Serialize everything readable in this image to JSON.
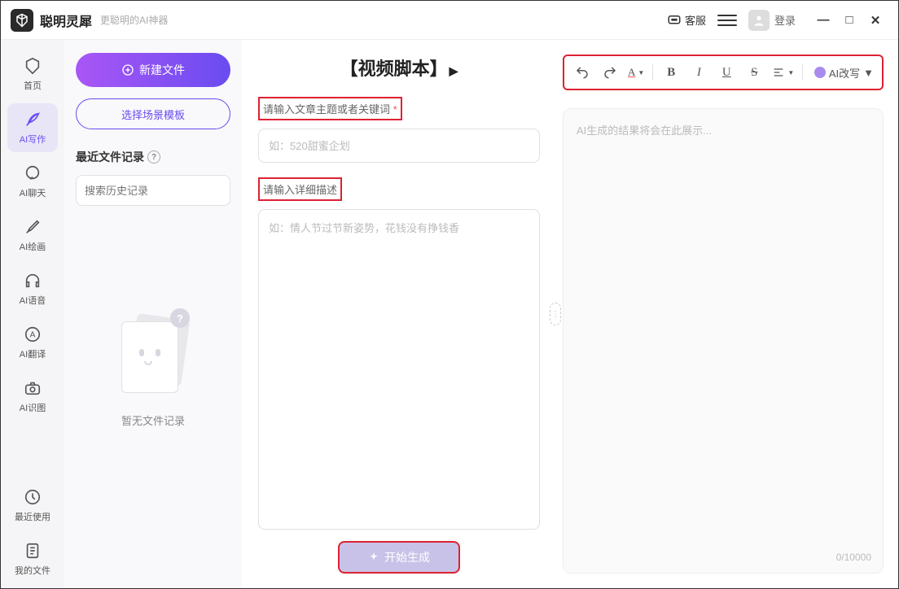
{
  "titlebar": {
    "app_name": "聪明灵犀",
    "tagline": "更聪明的AI神器",
    "support": "客服",
    "login": "登录"
  },
  "sidebar": {
    "items": [
      {
        "label": "首页"
      },
      {
        "label": "AI写作"
      },
      {
        "label": "AI聊天"
      },
      {
        "label": "AI绘画"
      },
      {
        "label": "AI语音"
      },
      {
        "label": "AI翻译"
      },
      {
        "label": "AI识图"
      },
      {
        "label": "最近使用"
      },
      {
        "label": "我的文件"
      }
    ]
  },
  "file_panel": {
    "new_file": "新建文件",
    "template": "选择场景模板",
    "recent_header": "最近文件记录",
    "search_placeholder": "搜索历史记录",
    "empty_text": "暂无文件记录"
  },
  "center": {
    "title": "【视频脚本】",
    "label_topic": "请输入文章主题或者关键词",
    "topic_placeholder": "如：520甜蜜企划",
    "label_desc": "请输入详细描述",
    "desc_placeholder": "如：情人节过节新姿势，花钱没有挣钱香",
    "generate": "开始生成"
  },
  "right": {
    "ai_rewrite": "AI改写",
    "output_placeholder": "AI生成的结果将会在此展示...",
    "char_count": "0/10000"
  }
}
